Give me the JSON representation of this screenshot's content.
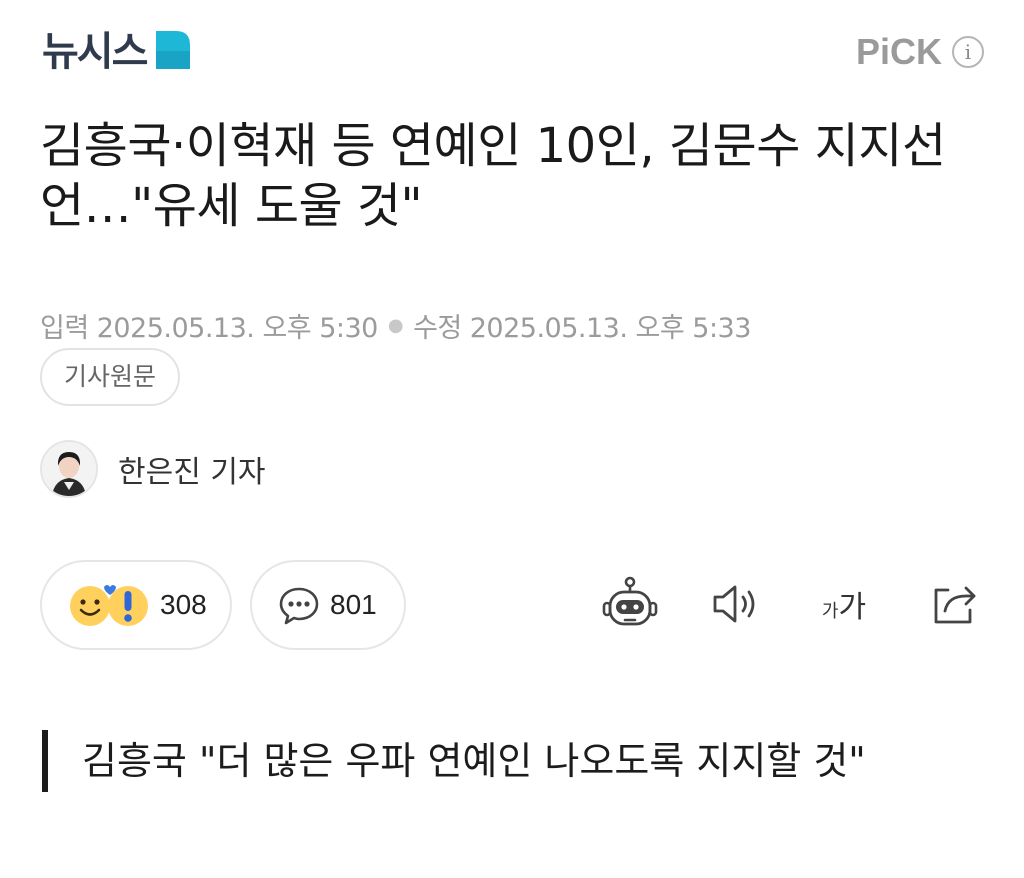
{
  "header": {
    "logo_text": "뉴시스",
    "pick_label": "PiCK",
    "info_icon": "i",
    "brand_color": "#2f3a4c",
    "accent_color": "#1fb7d6"
  },
  "article": {
    "title": "김흥국·이혁재 등 연예인 10인, 김문수 지지선언…\"유세 도울 것\"",
    "input_label": "입력",
    "input_time": "2025.05.13. 오후 5:30",
    "edit_label": "수정",
    "edit_time": "2025.05.13. 오후 5:33",
    "original_button": "기사원문",
    "author": "한은진 기자",
    "subheading": "김흥국 \"더 많은 우파 연예인 나오도록 지지할 것\""
  },
  "reactions": {
    "emotion_count": "308",
    "comment_count": "801"
  },
  "toolbar": {
    "font_size_small": "가",
    "font_size_large": "가"
  },
  "icons": [
    "info-icon",
    "emotion-icon",
    "comment-icon",
    "robot-summary-icon",
    "speaker-icon",
    "font-size-icon",
    "share-icon"
  ]
}
